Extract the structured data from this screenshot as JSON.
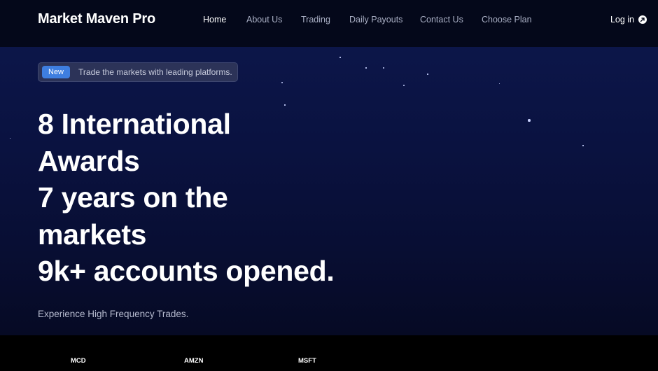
{
  "header": {
    "logo": "Market Maven Pro",
    "nav": [
      {
        "label": "Home",
        "active": true
      },
      {
        "label": "About Us",
        "active": false
      },
      {
        "label": "Trading",
        "active": false
      },
      {
        "label": "Daily Payouts",
        "active": false
      },
      {
        "label": "Contact Us",
        "active": false
      },
      {
        "label": "Choose Plan",
        "active": false
      }
    ],
    "login_label": "Log in",
    "login_icon": "arrow-circle-icon"
  },
  "hero": {
    "badge": "New",
    "badge_text": "Trade the markets with leading platforms.",
    "headline": [
      "8 International",
      "Awards",
      "7 years on the",
      "markets",
      "9k+ accounts opened."
    ],
    "subtitle": "Experience High Frequency Trades."
  },
  "ticker": {
    "symbols": [
      "MCD",
      "AMZN",
      "MSFT"
    ]
  },
  "colors": {
    "accent": "#3e7ee0",
    "hero_background": "#0a1240",
    "header_background": "#04081a"
  }
}
